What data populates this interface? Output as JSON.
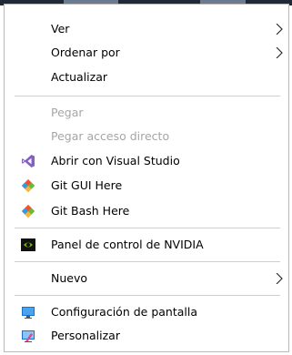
{
  "menu": {
    "items": [
      {
        "label": "Ver",
        "submenu": true,
        "enabled": true
      },
      {
        "label": "Ordenar por",
        "submenu": true,
        "enabled": true
      },
      {
        "label": "Actualizar",
        "submenu": false,
        "enabled": true
      },
      {
        "label": "Pegar",
        "submenu": false,
        "enabled": false
      },
      {
        "label": "Pegar acceso directo",
        "submenu": false,
        "enabled": false
      },
      {
        "label": "Abrir con Visual Studio",
        "icon": "visual-studio-icon",
        "submenu": false,
        "enabled": true
      },
      {
        "label": "Git GUI Here",
        "icon": "git-icon",
        "submenu": false,
        "enabled": true
      },
      {
        "label": "Git Bash Here",
        "icon": "git-icon",
        "submenu": false,
        "enabled": true
      },
      {
        "label": "Panel de control de NVIDIA",
        "icon": "nvidia-icon",
        "submenu": false,
        "enabled": true
      },
      {
        "label": "Nuevo",
        "submenu": true,
        "enabled": true
      },
      {
        "label": "Configuración de pantalla",
        "icon": "display-settings-icon",
        "submenu": false,
        "enabled": true
      },
      {
        "label": "Personalizar",
        "icon": "personalize-icon",
        "submenu": false,
        "enabled": true
      }
    ]
  },
  "colors": {
    "text": "#000000",
    "disabled_text": "#a6a6a6",
    "separator": "#cfcfcf",
    "border": "#b9b9b9",
    "visual_studio": "#865fc5",
    "git": "#f05133",
    "nvidia": "#76b900"
  }
}
